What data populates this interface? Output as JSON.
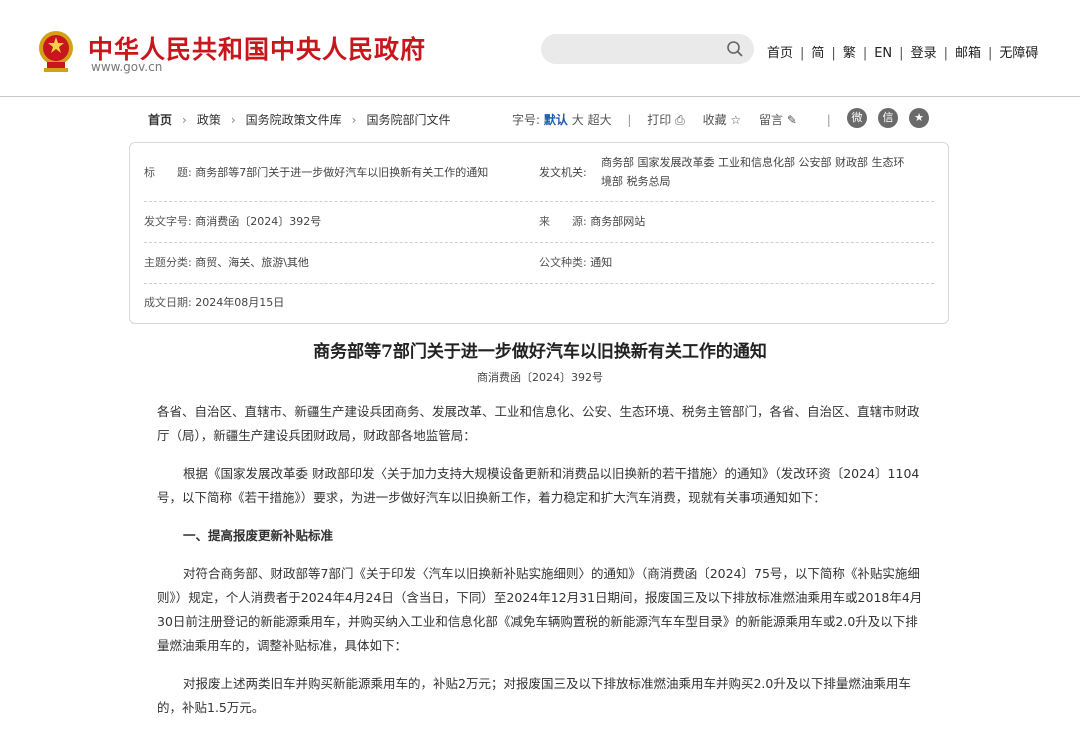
{
  "header": {
    "site_title": "中华人民共和国中央人民政府",
    "site_url": "www.gov.cn",
    "search_placeholder": "",
    "nav": [
      "首页",
      "简",
      "繁",
      "EN",
      "登录",
      "邮箱",
      "无障碍"
    ]
  },
  "breadcrumb": [
    "首页",
    "政策",
    "国务院政策文件库",
    "国务院部门文件"
  ],
  "toolbar": {
    "font_label": "字号:",
    "font_default": "默认",
    "font_large": "大",
    "font_xlarge": "超大",
    "print": "打印",
    "favorite": "收藏",
    "comment": "留言"
  },
  "info": {
    "title_label": "标　　题:",
    "title_value": "商务部等7部门关于进一步做好汽车以旧换新有关工作的通知",
    "issuer_label": "发文机关:",
    "issuer_value_line1": "商务部 国家发展改革委 工业和信息化部 公安部 财政部 生态环",
    "issuer_value_line2": "境部 税务总局",
    "docno_label": "发文字号:",
    "docno_value": "商消费函〔2024〕392号",
    "source_label": "来　　源:",
    "source_value": "商务部网站",
    "topic_label": "主题分类:",
    "topic_value": "商贸、海关、旅游\\其他",
    "type_label": "公文种类:",
    "type_value": "通知",
    "date_label": "成文日期:",
    "date_value": "2024年08月15日"
  },
  "article": {
    "title": "商务部等7部门关于进一步做好汽车以旧换新有关工作的通知",
    "doc_no": "商消费函〔2024〕392号",
    "p1": "各省、自治区、直辖市、新疆生产建设兵团商务、发展改革、工业和信息化、公安、生态环境、税务主管部门，各省、自治区、直辖市财政厅（局），新疆生产建设兵团财政局，财政部各地监管局：",
    "p2": "根据《国家发展改革委 财政部印发〈关于加力支持大规模设备更新和消费品以旧换新的若干措施〉的通知》（发改环资〔2024〕1104号，以下简称《若干措施》）要求，为进一步做好汽车以旧换新工作，着力稳定和扩大汽车消费，现就有关事项通知如下：",
    "section1": "一、提高报废更新补贴标准",
    "p3": "对符合商务部、财政部等7部门《关于印发〈汽车以旧换新补贴实施细则〉的通知》（商消费函〔2024〕75号，以下简称《补贴实施细则》）规定，个人消费者于2024年4月24日（含当日，下同）至2024年12月31日期间，报废国三及以下排放标准燃油乘用车或2018年4月30日前注册登记的新能源乘用车，并购买纳入工业和信息化部《减免车辆购置税的新能源汽车车型目录》的新能源乘用车或2.0升及以下排量燃油乘用车的，调整补贴标准，具体如下：",
    "p4": "对报废上述两类旧车并购买新能源乘用车的，补贴2万元；对报废国三及以下排放标准燃油乘用车并购买2.0升及以下排量燃油乘用车的，补贴1.5万元。"
  },
  "colors": {
    "brand_red": "#c8161d",
    "link_blue": "#1c5bb3"
  }
}
